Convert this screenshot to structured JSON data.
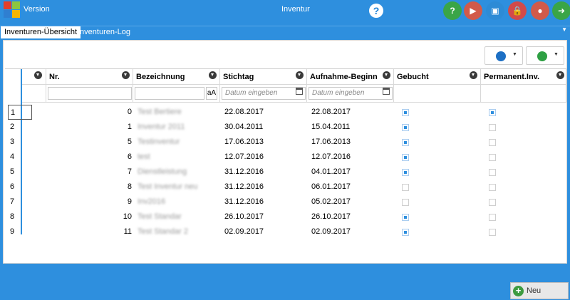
{
  "app": {
    "version_label": "Version",
    "title": "Inventur",
    "help_glyph": "?",
    "logo_colors": [
      "#e2402b",
      "#8cc63f",
      "#2f7fd1",
      "#f7b500"
    ],
    "toolbar_buttons": [
      {
        "name": "help-button",
        "icon": "question-icon",
        "color": "#3aa547",
        "glyph": "?"
      },
      {
        "name": "media-button",
        "icon": "presentation-icon",
        "color": "#d25a4a",
        "glyph": "▶"
      },
      {
        "name": "screen-button",
        "icon": "monitor-icon",
        "color": "#2d8bd6",
        "glyph": "▣"
      },
      {
        "name": "lock-button",
        "icon": "lock-icon",
        "color": "#d24a4a",
        "glyph": "🔒"
      },
      {
        "name": "user-button",
        "icon": "user-icon",
        "color": "#d25a4a",
        "glyph": "●"
      },
      {
        "name": "exit-button",
        "icon": "exit-icon",
        "color": "#3aa547",
        "glyph": "➜"
      }
    ]
  },
  "tabs": {
    "active": "Inventuren-Übersicht",
    "inactive": "Inventuren-Log",
    "menu_glyph": "▼"
  },
  "toolbar": {
    "print_color": "#1d6fc4",
    "export_color": "#2ea043",
    "dropdown_glyph": "▼"
  },
  "grid": {
    "columns": {
      "nr": "Nr.",
      "bezeichnung": "Bezeichnung",
      "stichtag": "Stichtag",
      "aufnahme": "Aufnahme-Beginn",
      "gebucht": "Gebucht",
      "permanent": "Permanent.Inv."
    },
    "filter": {
      "case_toggle": "aA",
      "date_placeholder": "Datum eingeben"
    },
    "rows": [
      {
        "row": "1",
        "nr": "0",
        "bez": "Test Bertiere",
        "stichtag": "22.08.2017",
        "aufnahme": "22.08.2017",
        "gebucht": true,
        "permanent": true
      },
      {
        "row": "2",
        "nr": "1",
        "bez": "Inventur 2011",
        "stichtag": "30.04.2011",
        "aufnahme": "15.04.2011",
        "gebucht": true,
        "permanent": false
      },
      {
        "row": "3",
        "nr": "5",
        "bez": "Testinventur",
        "stichtag": "17.06.2013",
        "aufnahme": "17.06.2013",
        "gebucht": true,
        "permanent": false
      },
      {
        "row": "4",
        "nr": "6",
        "bez": "test",
        "stichtag": "12.07.2016",
        "aufnahme": "12.07.2016",
        "gebucht": true,
        "permanent": false
      },
      {
        "row": "5",
        "nr": "7",
        "bez": "Dienstleistung",
        "stichtag": "31.12.2016",
        "aufnahme": "04.01.2017",
        "gebucht": true,
        "permanent": false
      },
      {
        "row": "6",
        "nr": "8",
        "bez": "Test Inventur neu",
        "stichtag": "31.12.2016",
        "aufnahme": "06.01.2017",
        "gebucht": false,
        "permanent": false
      },
      {
        "row": "7",
        "nr": "9",
        "bez": "Inv2016",
        "stichtag": "31.12.2016",
        "aufnahme": "05.02.2017",
        "gebucht": false,
        "permanent": false
      },
      {
        "row": "8",
        "nr": "10",
        "bez": "Test Standar",
        "stichtag": "26.10.2017",
        "aufnahme": "26.10.2017",
        "gebucht": true,
        "permanent": false
      },
      {
        "row": "9",
        "nr": "11",
        "bez": "Test Standar 2",
        "stichtag": "02.09.2017",
        "aufnahme": "02.09.2017",
        "gebucht": true,
        "permanent": false
      }
    ]
  },
  "actions": {
    "new_label": "Neu",
    "new_glyph": "+"
  }
}
